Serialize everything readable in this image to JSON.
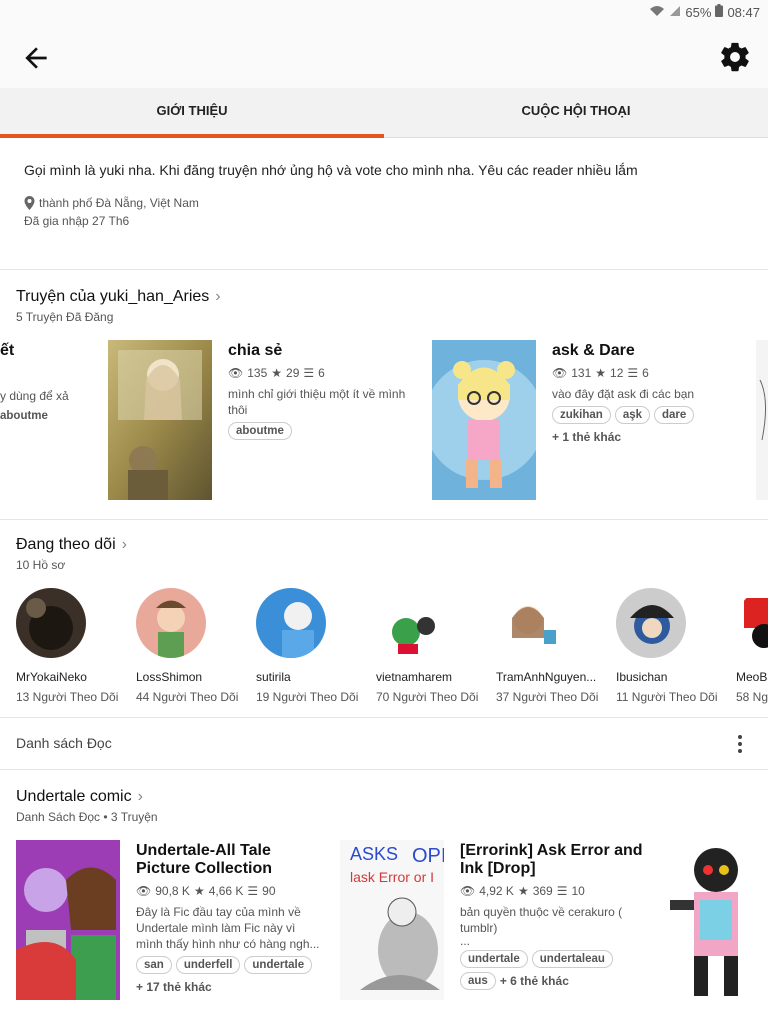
{
  "status": {
    "battery": "65%",
    "time": "08:47"
  },
  "tabs": [
    {
      "label": "GIỚI THIỆU"
    },
    {
      "label": "CUỘC HỘI THOẠI"
    }
  ],
  "about": {
    "bio": "Gọi mình là yuki nha. Khi đăng truyện nhớ ủng hộ và vote cho mình nha. Yêu các reader nhiều lắm",
    "location": "thành phố Đà Nẵng, Việt Nam",
    "joined": "Đã gia nhập 27 Th6"
  },
  "stories": {
    "title": "Truyện của yuki_han_Aries",
    "subtitle": "5 Truyện Đã Đăng",
    "partial_left": {
      "title": "ết",
      "desc": "y dùng để xả",
      "tag": "aboutme"
    },
    "items": [
      {
        "title": "chia sẻ",
        "views": "135",
        "votes": "29",
        "parts": "6",
        "desc": "mình chỉ giới thiệu một ít về mình thôi",
        "tags": [
          "aboutme"
        ]
      },
      {
        "title": "ask & Dare",
        "views": "131",
        "votes": "12",
        "parts": "6",
        "desc": "vào đây đặt ask đi các bạn",
        "tags": [
          "zukihan",
          "aşk",
          "dare"
        ],
        "more": "+ 1 thẻ khác"
      }
    ]
  },
  "following": {
    "title": "Đang theo dõi",
    "subtitle": "10 Hồ sơ",
    "people": [
      {
        "name": "MrYokaiNeko",
        "followers": "13 Người Theo Dõi"
      },
      {
        "name": "LossShimon",
        "followers": "44 Người Theo Dõi"
      },
      {
        "name": "sutirila",
        "followers": "19 Người Theo Dõi"
      },
      {
        "name": "vietnamharem",
        "followers": "70 Người Theo Dõi"
      },
      {
        "name": "TramAnhNguyen...",
        "followers": "37 Người Theo Dõi"
      },
      {
        "name": "Ibusichan",
        "followers": "11 Người Theo Dõi"
      },
      {
        "name": "MeoBa",
        "followers": "58 Ng"
      }
    ]
  },
  "reading_list_bar": {
    "label": "Danh sách Đọc"
  },
  "reading_list": {
    "title": "Undertale comic",
    "subtitle": "Danh Sách Đọc • 3 Truyện",
    "items": [
      {
        "title": "Undertale-All Tale Picture Collection",
        "views": "90,8 K",
        "votes": "4,66 K",
        "parts": "90",
        "desc": "Đây là Fic đầu tay của mình về Undertale mình làm Fic này vì mình thấy hình như có hàng ngh...",
        "tags": [
          "san",
          "underfell",
          "undertale"
        ],
        "more": "+ 17 thẻ khác"
      },
      {
        "title": "[Errorink] Ask Error and Ink [Drop]",
        "views": "4,92 K",
        "votes": "369",
        "parts": "10",
        "desc": "bản quyền thuộc về cerakuro ( tumblr)",
        "desc_more": "...",
        "tags": [
          "undertale",
          "undertaleau",
          "aus"
        ],
        "more": "+ 6 thẻ khác"
      }
    ]
  },
  "colors": {
    "accent": "#e65320"
  }
}
